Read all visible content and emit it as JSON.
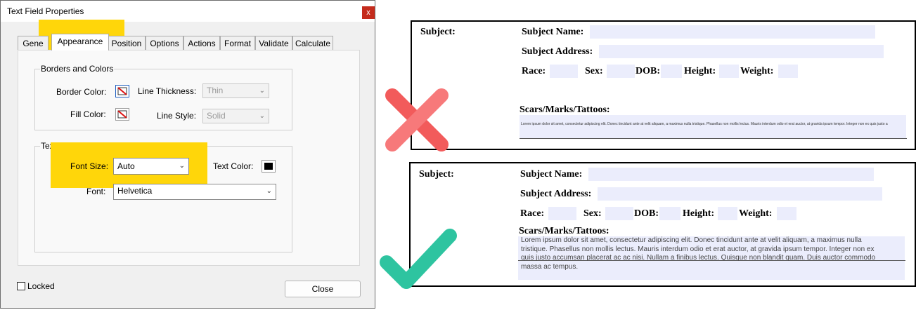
{
  "dialog": {
    "title": "Text Field Properties",
    "close_glyph": "x",
    "tabs": [
      "Gene",
      "Appearance",
      "Position",
      "Options",
      "Actions",
      "Format",
      "Validate",
      "Calculate"
    ],
    "active_tab": "Appearance",
    "borders_group": {
      "legend": "Borders and Colors",
      "border_color_label": "Border Color:",
      "fill_color_label": "Fill Color:",
      "line_thickness_label": "Line Thickness:",
      "line_thickness_value": "Thin",
      "line_style_label": "Line Style:",
      "line_style_value": "Solid"
    },
    "text_group": {
      "legend": "Text",
      "font_size_label": "Font Size:",
      "font_size_value": "Auto",
      "text_color_label": "Text Color:",
      "text_color": "#000000",
      "font_label": "Font:",
      "font_value": "Helvetica"
    },
    "locked_label": "Locked",
    "close_button": "Close",
    "highlight_color": "#ffd60a"
  },
  "form": {
    "subject": "Subject:",
    "subject_name": "Subject Name:",
    "subject_address": "Subject Address:",
    "race": "Race:",
    "sex": "Sex:",
    "dob": "DOB:",
    "height": "Height:",
    "weight": "Weight:",
    "scars": "Scars/Marks/Tattoos:",
    "field_color": "#ebedfc"
  },
  "bad_example": {
    "tiny_text": "Lorem ipsum dolor sit amet, consectetur adipiscing elit. Donec tincidunt ante at velit aliquam, a maximus nulla tristique. Phasellus non mollis lectus. Mauris interdum odio et erat auctor, at gravida ipsum tempor. Integer non ex quis justo a",
    "mark_color": "#f25b5b"
  },
  "good_example": {
    "lines": [
      "Lorem ipsum dolor sit amet, consectetur adipiscing elit. Donec tincidunt ante at velit aliquam, a maximus nulla",
      "tristique. Phasellus non mollis lectus. Mauris interdum odio et erat auctor, at gravida ipsum tempor. Integer non ex",
      "quis justo accumsan placerat ac ac nisi. Nullam a finibus lectus. Quisque non blandit quam. Duis auctor commodo",
      "massa ac tempus."
    ],
    "mark_color": "#2ec4a0"
  }
}
